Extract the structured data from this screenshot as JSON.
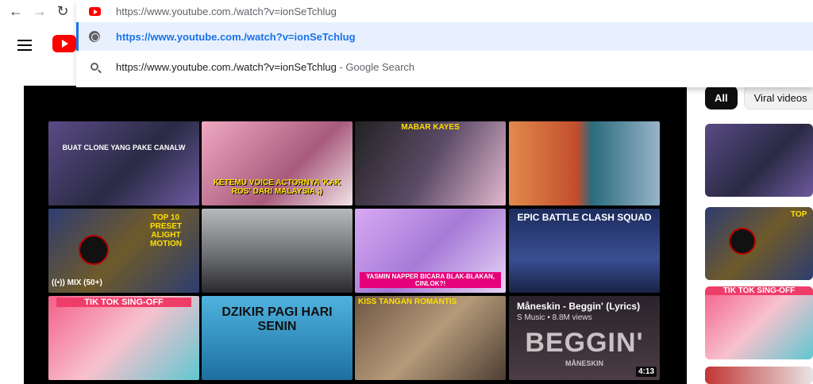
{
  "browser": {
    "omnibox_input": "https://www.youtube.com./watch?v=ionSeTchlug",
    "suggestions": [
      {
        "icon": "globe-icon",
        "text": "https://www.youtube.com./watch?v=ionSeTchlug"
      },
      {
        "icon": "search-icon",
        "text": "https://www.youtube.com./watch?v=ionSeTchlug",
        "suffix": "- Google Search"
      }
    ]
  },
  "mix_badge": "MIX (50+)",
  "tiles": [
    {
      "label": "BUAT CLONE YANG PAKE CANALW",
      "bg": "#4a3c6a"
    },
    {
      "label": "KETEMU VOICE ACTORNYA 'KAK ROS' DARI MALAYSIA ;)",
      "bg": "#d58ca8"
    },
    {
      "label": "MABAR KAYES",
      "bg": "#3f3b44"
    },
    {
      "label": "",
      "bg": "#d86a38"
    },
    {
      "label": "TOP 10 PRESET ALIGHT MOTION",
      "bg": "#2e3d71"
    },
    {
      "label": "",
      "bg": "#8e8f93"
    },
    {
      "label": "YASMIN NAPPER BICARA BLAK-BLAKAN, CINLOK?!",
      "bg": "#c78cf0"
    },
    {
      "label": "EPIC BATTLE CLASH SQUAD",
      "bg": "#24366e"
    },
    {
      "label": "TIK TOK SING-OFF",
      "bg": "#ef5a86"
    },
    {
      "label": "DZIKIR PAGI HARI SENIN",
      "bg": "#2c8ec4"
    },
    {
      "label": "KISS TANGAN ROMANTIS",
      "bg": "#8c6a4c"
    },
    {
      "label": "Måneskin - Beggin' (Lyrics)",
      "sub": "S Music • 8.8M views",
      "big": "BEGGIN'",
      "artist": "MÅNESKIN",
      "duration": "4:13",
      "bg": "#352c35"
    }
  ],
  "chips": [
    "All",
    "Viral videos"
  ],
  "sidebar": [
    {
      "label": "",
      "bg": "#4a3c6a"
    },
    {
      "label": "TOP",
      "bg": "#2e3d71"
    },
    {
      "label": "TIK TOK SING-OFF",
      "bg": "#ef5a86"
    },
    {
      "label": "",
      "bg": "#c23535"
    }
  ],
  "colors": {
    "youtube_red": "#ff0000",
    "link_blue": "#1a73e8"
  }
}
